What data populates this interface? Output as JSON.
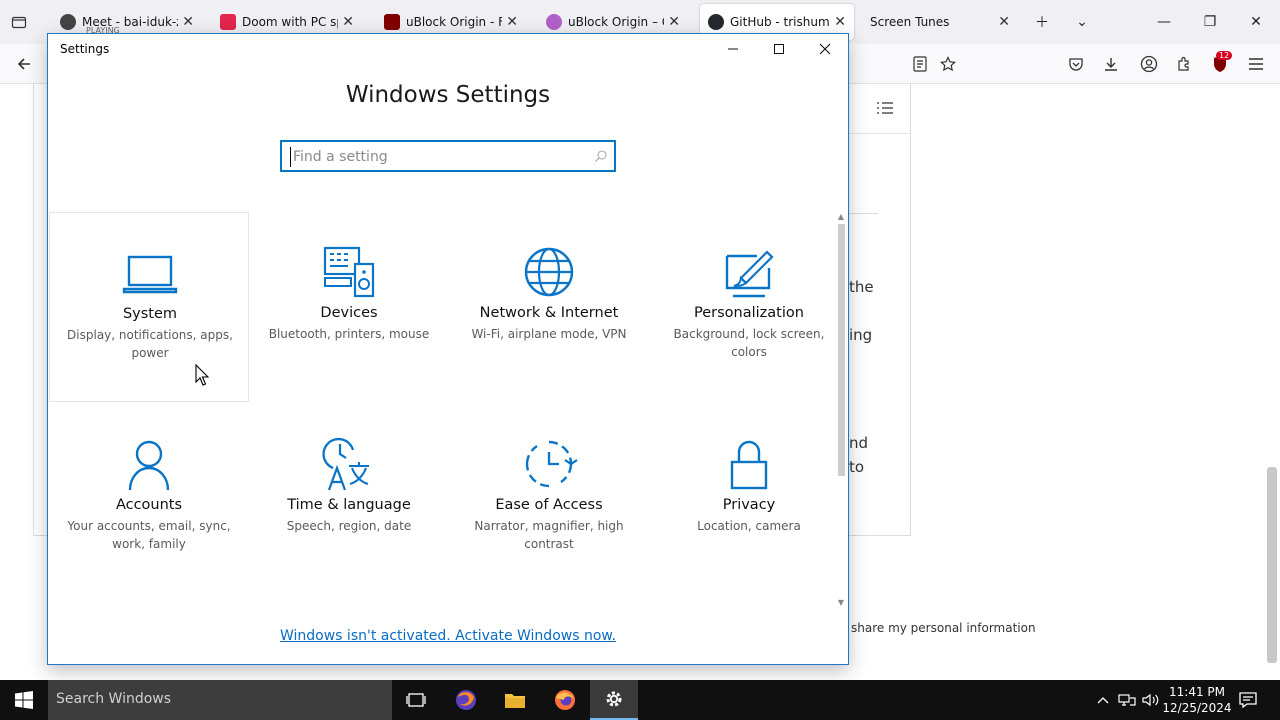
{
  "browser": {
    "tabs": [
      {
        "label": "Meet - bai-iduk-zyd",
        "sub": "PLAYING",
        "favicon": "meet-icon"
      },
      {
        "label": "Doom with PC spea",
        "favicon": "youtube-icon"
      },
      {
        "label": "uBlock Origin - Free",
        "favicon": "ublock-icon"
      },
      {
        "label": "uBlock Origin – Get",
        "favicon": "firefox-addons-icon"
      },
      {
        "label": "GitHub - trishume/",
        "favicon": "github-icon"
      },
      {
        "label": "Screen Tunes",
        "favicon": "none"
      }
    ],
    "extension_badge": "12"
  },
  "page": {
    "fragments": [
      "the",
      "ing",
      "nd",
      "to"
    ],
    "footer": "share my personal information"
  },
  "settings": {
    "window_title": "Settings",
    "heading": "Windows Settings",
    "search_placeholder": "Find a setting",
    "activate_link": "Windows isn't activated. Activate Windows now.",
    "accent": "#0a74c6",
    "tiles": [
      {
        "name": "System",
        "desc": "Display, notifications, apps, power",
        "icon": "laptop-icon"
      },
      {
        "name": "Devices",
        "desc": "Bluetooth, printers, mouse",
        "icon": "devices-icon"
      },
      {
        "name": "Network & Internet",
        "desc": "Wi-Fi, airplane mode, VPN",
        "icon": "globe-icon"
      },
      {
        "name": "Personalization",
        "desc": "Background, lock screen, colors",
        "icon": "paint-icon"
      },
      {
        "name": "Accounts",
        "desc": "Your accounts, email, sync, work, family",
        "icon": "person-icon"
      },
      {
        "name": "Time & language",
        "desc": "Speech, region, date",
        "icon": "time-language-icon"
      },
      {
        "name": "Ease of Access",
        "desc": "Narrator, magnifier, high contrast",
        "icon": "ease-of-access-icon"
      },
      {
        "name": "Privacy",
        "desc": "Location, camera",
        "icon": "lock-icon"
      }
    ]
  },
  "taskbar": {
    "search_placeholder": "Search Windows",
    "time": "11:41 PM",
    "date": "12/25/2024"
  }
}
